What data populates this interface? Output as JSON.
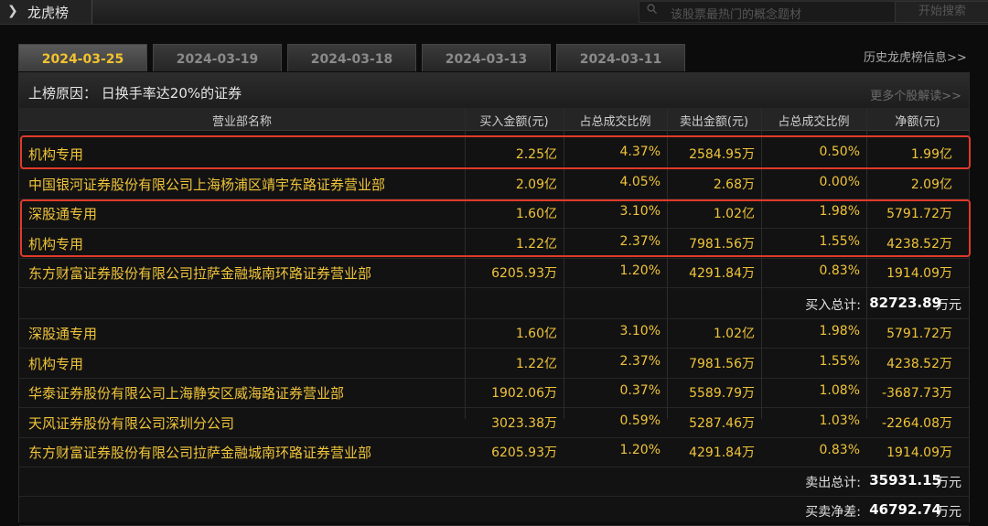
{
  "window": {
    "title": "龙虎榜"
  },
  "search": {
    "placeholder": "该股票最热门的概念题材",
    "button": "开始搜索"
  },
  "tabs": [
    {
      "label": "2024-03-25",
      "active": true
    },
    {
      "label": "2024-03-19",
      "active": false
    },
    {
      "label": "2024-03-18",
      "active": false
    },
    {
      "label": "2024-03-13",
      "active": false
    },
    {
      "label": "2024-03-11",
      "active": false
    }
  ],
  "history_link": "历史龙虎榜信息>>",
  "reason": {
    "label": "上榜原因：  日换手率达20%的证券",
    "more": "更多个股解读>>"
  },
  "columns": [
    "营业部名称",
    "买入金额(元)",
    "占总成交比例",
    "卖出金额(元)",
    "占总成交比例",
    "净额(元)"
  ],
  "buy_rows": [
    [
      "机构专用",
      "2.25亿",
      "4.37%",
      "2584.95万",
      "0.50%",
      "1.99亿"
    ],
    [
      "中国银河证券股份有限公司上海杨浦区靖宇东路证券营业部",
      "2.09亿",
      "4.05%",
      "2.68万",
      "0.00%",
      "2.09亿"
    ],
    [
      "深股通专用",
      "1.60亿",
      "3.10%",
      "1.02亿",
      "1.98%",
      "5791.72万"
    ],
    [
      "机构专用",
      "1.22亿",
      "2.37%",
      "7981.56万",
      "1.55%",
      "4238.52万"
    ],
    [
      "东方财富证券股份有限公司拉萨金融城南环路证券营业部",
      "6205.93万",
      "1.20%",
      "4291.84万",
      "0.83%",
      "1914.09万"
    ]
  ],
  "buy_total": {
    "label": "买入总计:",
    "value": "82723.89",
    "unit": "万元"
  },
  "sell_rows": [
    [
      "深股通专用",
      "1.60亿",
      "3.10%",
      "1.02亿",
      "1.98%",
      "5791.72万"
    ],
    [
      "机构专用",
      "1.22亿",
      "2.37%",
      "7981.56万",
      "1.55%",
      "4238.52万"
    ],
    [
      "华泰证券股份有限公司上海静安区威海路证券营业部",
      "1902.06万",
      "0.37%",
      "5589.79万",
      "1.08%",
      "-3687.73万"
    ],
    [
      "天风证券股份有限公司深圳分公司",
      "3023.38万",
      "0.59%",
      "5287.46万",
      "1.03%",
      "-2264.08万"
    ],
    [
      "东方财富证券股份有限公司拉萨金融城南环路证券营业部",
      "6205.93万",
      "1.20%",
      "4291.84万",
      "0.83%",
      "1914.09万"
    ]
  ],
  "sell_total": {
    "label": "卖出总计:",
    "value": "35931.15",
    "unit": "万元"
  },
  "net_total": {
    "label": "买卖净差:",
    "value": "46792.74",
    "unit": "万元"
  },
  "colors": {
    "highlight": "#e03a2a",
    "value": "#f0c43a",
    "active_tab": "#f2c230"
  }
}
